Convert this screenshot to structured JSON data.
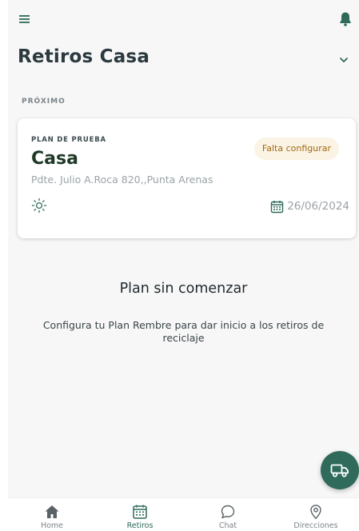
{
  "header": {
    "menu_icon": "menu-icon",
    "notification_icon": "bell-icon",
    "page_title": "Retiros Casa",
    "dropdown_icon": "chevron-down-icon"
  },
  "section": {
    "label": "PRÓXIMO"
  },
  "plan_card": {
    "overline": "PLAN DE PRUEBA",
    "title": "Casa",
    "address": "Pdte. Julio A.Roca 820,,Punta Arenas",
    "status": "Falta configurar",
    "weather_icon": "sun-icon",
    "date_icon": "calendar-icon",
    "date": "26/06/2024"
  },
  "empty_state": {
    "title": "Plan sin comenzar",
    "description": "Configura tu Plan Rembre para dar inicio a los retiros de reciclaje"
  },
  "fab": {
    "icon": "truck-icon"
  },
  "bottom_nav": {
    "active": "Retiros",
    "items": [
      {
        "label": "Home",
        "icon": "home-icon"
      },
      {
        "label": "Retiros",
        "icon": "calendar-icon"
      },
      {
        "label": "Chat",
        "icon": "chat-bubble-icon"
      },
      {
        "label": "Direcciones",
        "icon": "map-pin-icon"
      }
    ]
  },
  "colors": {
    "primary": "#2f6a5a",
    "title_dark": "#2b3a3f",
    "badge_bg": "#fbf3e4",
    "badge_text": "#a06a12",
    "muted": "#9aa3a7",
    "background": "#f7f7f7"
  }
}
